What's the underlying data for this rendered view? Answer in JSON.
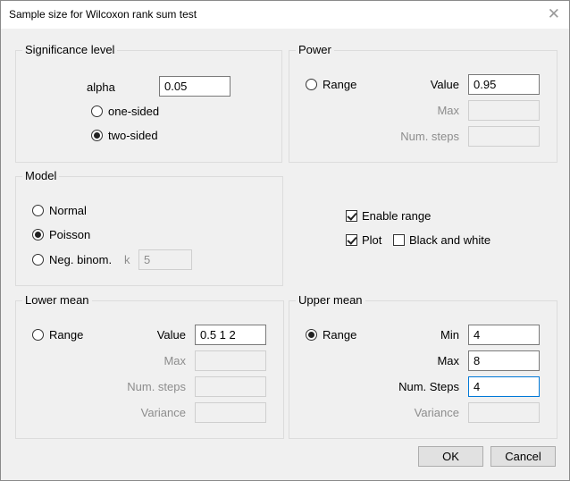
{
  "window": {
    "title": "Sample size for Wilcoxon rank sum test",
    "close_glyph": "✕"
  },
  "significance": {
    "title": "Significance level",
    "alpha_label": "alpha",
    "alpha_value": "0.05",
    "one_sided_label": "one-sided",
    "two_sided_label": "two-sided",
    "selected": "two-sided"
  },
  "power": {
    "title": "Power",
    "range_label": "Range",
    "value_label": "Value",
    "value": "0.95",
    "max_label": "Max",
    "max_value": "",
    "num_steps_label": "Num. steps",
    "num_steps_value": ""
  },
  "model": {
    "title": "Model",
    "normal_label": "Normal",
    "poisson_label": "Poisson",
    "negbinom_label": "Neg. binom.",
    "k_label": "k",
    "k_value": "5",
    "selected": "Poisson"
  },
  "options": {
    "enable_range_label": "Enable range",
    "enable_range_checked": true,
    "plot_label": "Plot",
    "plot_checked": true,
    "bw_label": "Black and white",
    "bw_checked": false
  },
  "lower_mean": {
    "title": "Lower mean",
    "range_label": "Range",
    "value_label": "Value",
    "value": "0.5 1 2",
    "max_label": "Max",
    "max_value": "",
    "num_steps_label": "Num. steps",
    "num_steps_value": "",
    "variance_label": "Variance",
    "variance_value": ""
  },
  "upper_mean": {
    "title": "Upper mean",
    "range_label": "Range",
    "range_checked": true,
    "min_label": "Min",
    "min_value": "4",
    "max_label": "Max",
    "max_value": "8",
    "num_steps_label": "Num. Steps",
    "num_steps_value": "4",
    "variance_label": "Variance",
    "variance_value": ""
  },
  "buttons": {
    "ok": "OK",
    "cancel": "Cancel"
  }
}
